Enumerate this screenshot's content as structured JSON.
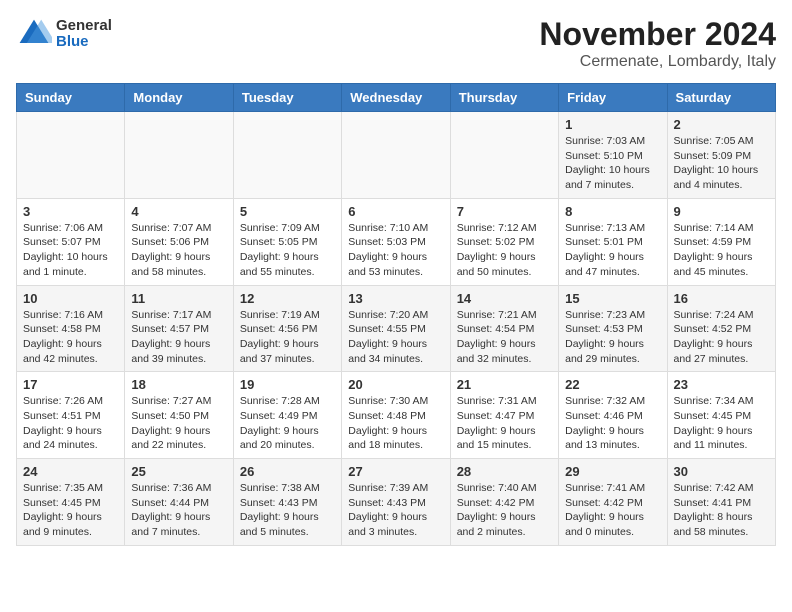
{
  "header": {
    "logo_general": "General",
    "logo_blue": "Blue",
    "title": "November 2024",
    "subtitle": "Cermenate, Lombardy, Italy"
  },
  "weekdays": [
    "Sunday",
    "Monday",
    "Tuesday",
    "Wednesday",
    "Thursday",
    "Friday",
    "Saturday"
  ],
  "weeks": [
    [
      {
        "day": "",
        "detail": ""
      },
      {
        "day": "",
        "detail": ""
      },
      {
        "day": "",
        "detail": ""
      },
      {
        "day": "",
        "detail": ""
      },
      {
        "day": "",
        "detail": ""
      },
      {
        "day": "1",
        "detail": "Sunrise: 7:03 AM\nSunset: 5:10 PM\nDaylight: 10 hours and 7 minutes."
      },
      {
        "day": "2",
        "detail": "Sunrise: 7:05 AM\nSunset: 5:09 PM\nDaylight: 10 hours and 4 minutes."
      }
    ],
    [
      {
        "day": "3",
        "detail": "Sunrise: 7:06 AM\nSunset: 5:07 PM\nDaylight: 10 hours and 1 minute."
      },
      {
        "day": "4",
        "detail": "Sunrise: 7:07 AM\nSunset: 5:06 PM\nDaylight: 9 hours and 58 minutes."
      },
      {
        "day": "5",
        "detail": "Sunrise: 7:09 AM\nSunset: 5:05 PM\nDaylight: 9 hours and 55 minutes."
      },
      {
        "day": "6",
        "detail": "Sunrise: 7:10 AM\nSunset: 5:03 PM\nDaylight: 9 hours and 53 minutes."
      },
      {
        "day": "7",
        "detail": "Sunrise: 7:12 AM\nSunset: 5:02 PM\nDaylight: 9 hours and 50 minutes."
      },
      {
        "day": "8",
        "detail": "Sunrise: 7:13 AM\nSunset: 5:01 PM\nDaylight: 9 hours and 47 minutes."
      },
      {
        "day": "9",
        "detail": "Sunrise: 7:14 AM\nSunset: 4:59 PM\nDaylight: 9 hours and 45 minutes."
      }
    ],
    [
      {
        "day": "10",
        "detail": "Sunrise: 7:16 AM\nSunset: 4:58 PM\nDaylight: 9 hours and 42 minutes."
      },
      {
        "day": "11",
        "detail": "Sunrise: 7:17 AM\nSunset: 4:57 PM\nDaylight: 9 hours and 39 minutes."
      },
      {
        "day": "12",
        "detail": "Sunrise: 7:19 AM\nSunset: 4:56 PM\nDaylight: 9 hours and 37 minutes."
      },
      {
        "day": "13",
        "detail": "Sunrise: 7:20 AM\nSunset: 4:55 PM\nDaylight: 9 hours and 34 minutes."
      },
      {
        "day": "14",
        "detail": "Sunrise: 7:21 AM\nSunset: 4:54 PM\nDaylight: 9 hours and 32 minutes."
      },
      {
        "day": "15",
        "detail": "Sunrise: 7:23 AM\nSunset: 4:53 PM\nDaylight: 9 hours and 29 minutes."
      },
      {
        "day": "16",
        "detail": "Sunrise: 7:24 AM\nSunset: 4:52 PM\nDaylight: 9 hours and 27 minutes."
      }
    ],
    [
      {
        "day": "17",
        "detail": "Sunrise: 7:26 AM\nSunset: 4:51 PM\nDaylight: 9 hours and 24 minutes."
      },
      {
        "day": "18",
        "detail": "Sunrise: 7:27 AM\nSunset: 4:50 PM\nDaylight: 9 hours and 22 minutes."
      },
      {
        "day": "19",
        "detail": "Sunrise: 7:28 AM\nSunset: 4:49 PM\nDaylight: 9 hours and 20 minutes."
      },
      {
        "day": "20",
        "detail": "Sunrise: 7:30 AM\nSunset: 4:48 PM\nDaylight: 9 hours and 18 minutes."
      },
      {
        "day": "21",
        "detail": "Sunrise: 7:31 AM\nSunset: 4:47 PM\nDaylight: 9 hours and 15 minutes."
      },
      {
        "day": "22",
        "detail": "Sunrise: 7:32 AM\nSunset: 4:46 PM\nDaylight: 9 hours and 13 minutes."
      },
      {
        "day": "23",
        "detail": "Sunrise: 7:34 AM\nSunset: 4:45 PM\nDaylight: 9 hours and 11 minutes."
      }
    ],
    [
      {
        "day": "24",
        "detail": "Sunrise: 7:35 AM\nSunset: 4:45 PM\nDaylight: 9 hours and 9 minutes."
      },
      {
        "day": "25",
        "detail": "Sunrise: 7:36 AM\nSunset: 4:44 PM\nDaylight: 9 hours and 7 minutes."
      },
      {
        "day": "26",
        "detail": "Sunrise: 7:38 AM\nSunset: 4:43 PM\nDaylight: 9 hours and 5 minutes."
      },
      {
        "day": "27",
        "detail": "Sunrise: 7:39 AM\nSunset: 4:43 PM\nDaylight: 9 hours and 3 minutes."
      },
      {
        "day": "28",
        "detail": "Sunrise: 7:40 AM\nSunset: 4:42 PM\nDaylight: 9 hours and 2 minutes."
      },
      {
        "day": "29",
        "detail": "Sunrise: 7:41 AM\nSunset: 4:42 PM\nDaylight: 9 hours and 0 minutes."
      },
      {
        "day": "30",
        "detail": "Sunrise: 7:42 AM\nSunset: 4:41 PM\nDaylight: 8 hours and 58 minutes."
      }
    ]
  ]
}
